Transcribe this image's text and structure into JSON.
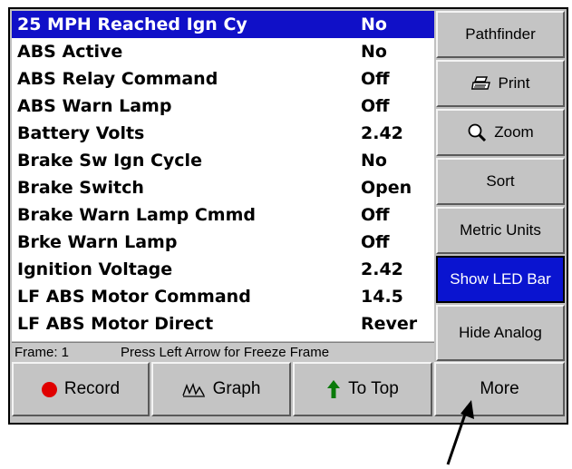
{
  "data_list": {
    "rows": [
      {
        "name": "25 MPH Reached Ign Cy",
        "value": "No"
      },
      {
        "name": "ABS Active",
        "value": "No"
      },
      {
        "name": "ABS Relay Command",
        "value": "Off"
      },
      {
        "name": "ABS Warn Lamp",
        "value": "Off"
      },
      {
        "name": "Battery Volts",
        "value": "2.42"
      },
      {
        "name": "Brake Sw Ign Cycle",
        "value": "No"
      },
      {
        "name": "Brake Switch",
        "value": "Open"
      },
      {
        "name": "Brake Warn Lamp Cmmd",
        "value": "Off"
      },
      {
        "name": "Brke Warn Lamp",
        "value": "Off"
      },
      {
        "name": "Ignition Voltage",
        "value": "2.42"
      },
      {
        "name": "LF ABS Motor Command",
        "value": "14.5"
      },
      {
        "name": "LF ABS Motor Direct",
        "value": "Rever"
      }
    ]
  },
  "status": {
    "frame": "Frame: 1",
    "hint": "Press Left Arrow for Freeze Frame"
  },
  "side_buttons": {
    "pathfinder": "Pathfinder",
    "print": "Print",
    "zoom": "Zoom",
    "sort": "Sort",
    "metric_units": "Metric Units",
    "show_led_bar": "Show LED Bar",
    "hide_analog": "Hide Analog"
  },
  "bottom_buttons": {
    "record": "Record",
    "graph": "Graph",
    "to_top": "To Top",
    "more": "More"
  },
  "colors": {
    "selection": "#1010c8",
    "active_button": "#0a14d0",
    "record_dot": "#e00000",
    "to_top_arrow": "#0a7a0a"
  }
}
